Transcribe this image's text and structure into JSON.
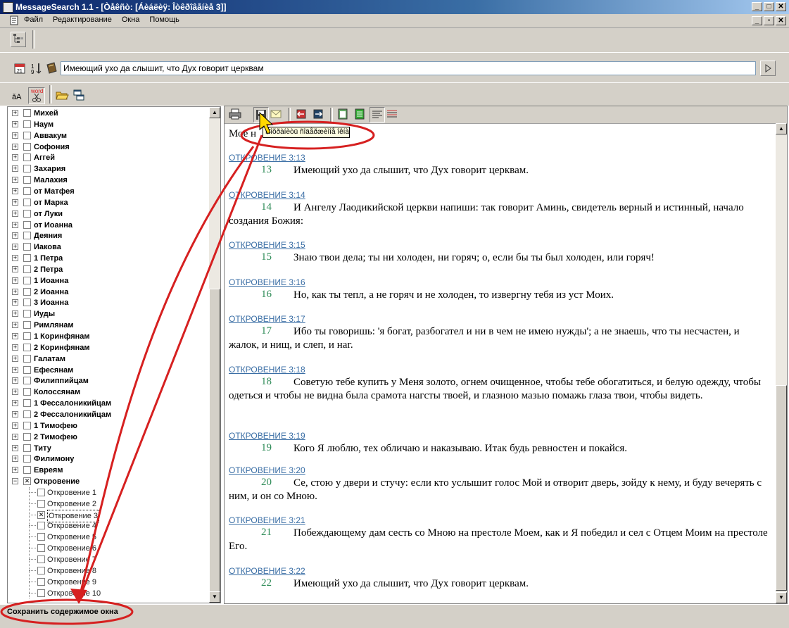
{
  "window": {
    "title": "MessageSearch 1.1 - [Òåêñò: [Áèáëèÿ: Îòêðîâåíèå 3]]",
    "controls": [
      "_",
      "□",
      "✕"
    ]
  },
  "menu": {
    "items": [
      "Файл",
      "Редактирование",
      "Окна",
      "Помощь"
    ],
    "doc_controls": [
      "_",
      "▫",
      "✕"
    ]
  },
  "search": {
    "value": "Имеющий ухо да слышит, что Дух говорит церквам"
  },
  "toolbar3": {
    "word_label": "word"
  },
  "tree": [
    {
      "label": "Михей",
      "bold": true,
      "expander": "+",
      "checked": false
    },
    {
      "label": "Наум",
      "bold": true,
      "expander": "+",
      "checked": false
    },
    {
      "label": "Аввакум",
      "bold": true,
      "expander": "+",
      "checked": false
    },
    {
      "label": "Софония",
      "bold": true,
      "expander": "+",
      "checked": false
    },
    {
      "label": "Аггей",
      "bold": true,
      "expander": "+",
      "checked": false
    },
    {
      "label": "Захария",
      "bold": true,
      "expander": "+",
      "checked": false
    },
    {
      "label": "Малахия",
      "bold": true,
      "expander": "+",
      "checked": false
    },
    {
      "label": "от Матфея",
      "bold": true,
      "expander": "+",
      "checked": false
    },
    {
      "label": "от Марка",
      "bold": true,
      "expander": "+",
      "checked": false
    },
    {
      "label": "от Луки",
      "bold": true,
      "expander": "+",
      "checked": false
    },
    {
      "label": "от Иоанна",
      "bold": true,
      "expander": "+",
      "checked": false
    },
    {
      "label": "Деяния",
      "bold": true,
      "expander": "+",
      "checked": false
    },
    {
      "label": "Иакова",
      "bold": true,
      "expander": "+",
      "checked": false
    },
    {
      "label": "1 Петра",
      "bold": true,
      "expander": "+",
      "checked": false
    },
    {
      "label": "2 Петра",
      "bold": true,
      "expander": "+",
      "checked": false
    },
    {
      "label": "1 Иоанна",
      "bold": true,
      "expander": "+",
      "checked": false
    },
    {
      "label": "2 Иоанна",
      "bold": true,
      "expander": "+",
      "checked": false
    },
    {
      "label": "3 Иоанна",
      "bold": true,
      "expander": "+",
      "checked": false
    },
    {
      "label": "Иуды",
      "bold": true,
      "expander": "+",
      "checked": false
    },
    {
      "label": "Римлянам",
      "bold": true,
      "expander": "+",
      "checked": false
    },
    {
      "label": "1 Коринфянам",
      "bold": true,
      "expander": "+",
      "checked": false
    },
    {
      "label": "2 Коринфянам",
      "bold": true,
      "expander": "+",
      "checked": false
    },
    {
      "label": "Галатам",
      "bold": true,
      "expander": "+",
      "checked": false
    },
    {
      "label": "Ефесянам",
      "bold": true,
      "expander": "+",
      "checked": false
    },
    {
      "label": "Филиппийцам",
      "bold": true,
      "expander": "+",
      "checked": false
    },
    {
      "label": "Колоссянам",
      "bold": true,
      "expander": "+",
      "checked": false
    },
    {
      "label": "1 Фессалоникийцам",
      "bold": true,
      "expander": "+",
      "checked": false
    },
    {
      "label": "2 Фессалоникийцам",
      "bold": true,
      "expander": "+",
      "checked": false
    },
    {
      "label": "1 Тимофею",
      "bold": true,
      "expander": "+",
      "checked": false
    },
    {
      "label": "2 Тимофею",
      "bold": true,
      "expander": "+",
      "checked": false
    },
    {
      "label": "Титу",
      "bold": true,
      "expander": "+",
      "checked": false
    },
    {
      "label": "Филимону",
      "bold": true,
      "expander": "+",
      "checked": false
    },
    {
      "label": "Евреям",
      "bold": true,
      "expander": "+",
      "checked": false
    },
    {
      "label": "Откровение",
      "bold": true,
      "expander": "−",
      "checked": true
    },
    {
      "label": "Откровение 1",
      "bold": false,
      "expander": "",
      "checked": false
    },
    {
      "label": "Откровение 2",
      "bold": false,
      "expander": "",
      "checked": false
    },
    {
      "label": "Откровение 3",
      "bold": false,
      "expander": "",
      "checked": true,
      "selected": true
    },
    {
      "label": "Откровение 4",
      "bold": false,
      "expander": "",
      "checked": false
    },
    {
      "label": "Откровение 5",
      "bold": false,
      "expander": "",
      "checked": false
    },
    {
      "label": "Откровение 6",
      "bold": false,
      "expander": "",
      "checked": false
    },
    {
      "label": "Откровение 7",
      "bold": false,
      "expander": "",
      "checked": false
    },
    {
      "label": "Откровение 8",
      "bold": false,
      "expander": "",
      "checked": false
    },
    {
      "label": "Откровение 9",
      "bold": false,
      "expander": "",
      "checked": false
    },
    {
      "label": "Откровение 10",
      "bold": false,
      "expander": "",
      "checked": false
    }
  ],
  "content": {
    "partial_top": "Мое н",
    "verses": [
      {
        "ref": "ОТКРОВЕНИЕ 3:13",
        "num": "13",
        "text": "Имеющий ухо да слышит, что Дух говорит церквам."
      },
      {
        "ref": "ОТКРОВЕНИЕ 3:14",
        "num": "14",
        "text": "И Ангелу Лаодикийской церкви напиши: так говорит Аминь, свидетель верный и истинный, начало создания Божия:"
      },
      {
        "ref": "ОТКРОВЕНИЕ 3:15",
        "num": "15",
        "text": "Знаю твои дела; ты ни холоден, ни горяч; о, если бы ты был холоден, или горяч!"
      },
      {
        "ref": "ОТКРОВЕНИЕ 3:16",
        "num": "16",
        "text": "Но, как ты тепл, а не горяч и не холоден, то извергну тебя из уст Моих."
      },
      {
        "ref": "ОТКРОВЕНИЕ 3:17",
        "num": "17",
        "text": "Ибо ты говоришь: 'я богат, разбогател и ни в чем не имею нужды'; а не знаешь, что ты несчастен, и жалок, и нищ, и слеп, и наг."
      },
      {
        "ref": "ОТКРОВЕНИЕ 3:18",
        "num": "18",
        "text": "Советую тебе купить у Меня золото, огнем очищенное, чтобы тебе обогатиться, и белую одежду, чтобы одеться и чтобы не видна была срамота нагсты твоей, и глазною мазью помажь глаза твои, чтобы видеть."
      },
      {
        "ref": "ОТКРОВЕНИЕ 3:19",
        "num": "19",
        "text": "Кого Я люблю, тех обличаю и наказываю. Итак будь ревностен и покайся."
      },
      {
        "ref": "ОТКРОВЕНИЕ 3:20",
        "num": "20",
        "text": "Се, стою у двери и стучу: если кто услышит голос Мой и отворит дверь, зойду к нему, и буду вечерять с ним, и он со Мною."
      },
      {
        "ref": "ОТКРОВЕНИЕ 3:21",
        "num": "21",
        "text": "Побеждающему дам сесть со Мною на престоле Моем, как и Я победил и сел с Отцем Моим на престоле Его."
      },
      {
        "ref": "ОТКРОВЕНИЕ 3:22",
        "num": "22",
        "text": "Имеющий ухо да слышит, что Дух говорит церквам."
      }
    ]
  },
  "tooltip": {
    "text": "Ñîõðàíèòü ñîäåðæèìîå îêíà"
  },
  "status": {
    "text": "Сохранить содержимое окна"
  },
  "colors": {
    "annotation": "#d62020",
    "ref_link": "#3a6ea5",
    "verse_num": "#2e8b57",
    "titlebar": "#0a246a"
  }
}
